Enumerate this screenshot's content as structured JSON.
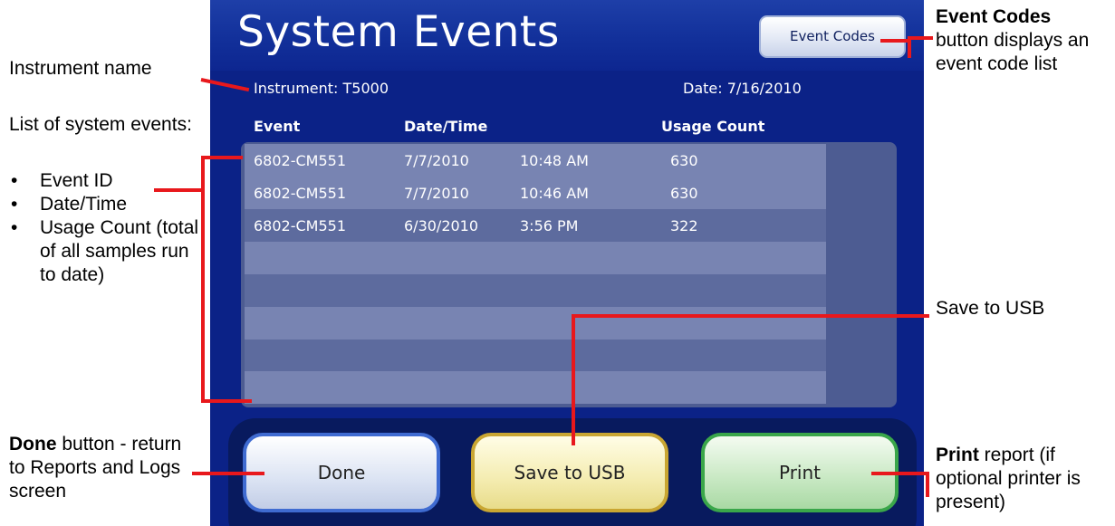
{
  "screen": {
    "title": "System Events",
    "event_codes_button": "Event Codes",
    "instrument_label": "Instrument: T5000",
    "date_label": "Date: 7/16/2010",
    "columns": [
      "Event",
      "Date/Time",
      "Usage Count"
    ],
    "rows": [
      {
        "event": "6802-CM551",
        "date": "7/7/2010",
        "time": "10:48 AM",
        "usage": "630"
      },
      {
        "event": "6802-CM551",
        "date": "7/7/2010",
        "time": "10:46 AM",
        "usage": "630"
      },
      {
        "event": "6802-CM551",
        "date": "6/30/2010",
        "time": "3:56 PM",
        "usage": "322"
      },
      {
        "event": "",
        "date": "",
        "time": "",
        "usage": ""
      },
      {
        "event": "",
        "date": "",
        "time": "",
        "usage": ""
      },
      {
        "event": "",
        "date": "",
        "time": "",
        "usage": ""
      },
      {
        "event": "",
        "date": "",
        "time": "",
        "usage": ""
      },
      {
        "event": "",
        "date": "",
        "time": "",
        "usage": ""
      }
    ],
    "buttons": {
      "done": "Done",
      "save_usb": "Save to USB",
      "print": "Print"
    }
  },
  "annotations": {
    "instrument_name": "Instrument name",
    "list_intro": "List of system events:",
    "list_items": [
      "Event ID",
      "Date/Time",
      "Usage Count (total of all samples run to date)"
    ],
    "event_codes_bold": "Event Codes",
    "event_codes_rest": "button displays an event code list",
    "save_usb": "Save to USB",
    "done_bold": "Done",
    "done_rest": " button - return to Reports and Logs screen",
    "print_bold": "Print",
    "print_rest": " report (if optional printer is present)"
  },
  "colors": {
    "screen_bg": "#0b2287",
    "annotation_line": "#e8181c"
  }
}
